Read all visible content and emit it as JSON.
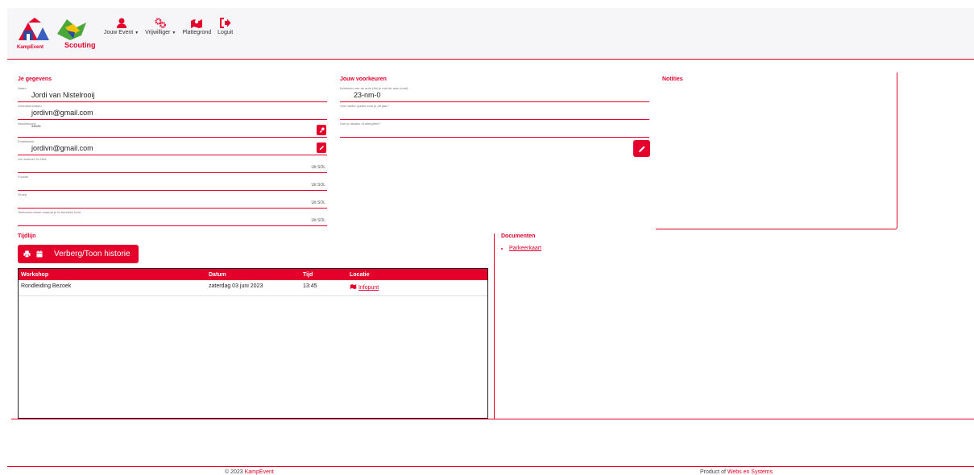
{
  "header": {
    "logo_text_1": "KampEvent",
    "logo_text_2": "Scouting",
    "nav": [
      {
        "label": "Jouw Event",
        "icon": "user-icon",
        "has_caret": true
      },
      {
        "label": "Vrijwilliger",
        "icon": "gears-icon",
        "has_caret": true
      },
      {
        "label": "Plattegrond",
        "icon": "map-icon",
        "has_caret": false
      },
      {
        "label": "Loguit",
        "icon": "sign-out-icon",
        "has_caret": false
      }
    ]
  },
  "personal": {
    "title": "Je gegevens",
    "fields": [
      {
        "label": "Naam",
        "value": "Jordi van Nistelrooij"
      },
      {
        "label": "Gebruikersnaam",
        "value": "jordivn@gmail.com"
      },
      {
        "label": "Wachtwoord",
        "value": "*****"
      },
      {
        "label": "Emailadres",
        "value": "jordivn@gmail.com"
      },
      {
        "label": "Lid nummer Sc Ned.",
        "value": "",
        "suffix": "Uit SOL"
      },
      {
        "label": "Functie",
        "value": "",
        "suffix": "Uit SOL"
      },
      {
        "label": "Groep",
        "value": "",
        "suffix": "Uit SOL"
      },
      {
        "label": "Telefoonnummer waarop je te bereiken bent",
        "value": "",
        "suffix": "Uit SOL"
      }
    ]
  },
  "preferences": {
    "title": "Jouw voorkeuren",
    "fields": [
      {
        "label": "Kenteken van de auto (Als je met de auto komt)",
        "value": "23-nm-0"
      },
      {
        "label": "Voor welke spelbe kom je dit jaar?",
        "value": ""
      },
      {
        "label": "Hoe je disdeln of allergieën?",
        "value": ""
      }
    ]
  },
  "notes": {
    "title": "Notities"
  },
  "timeline": {
    "title": "Tijdlijn",
    "toggle_label": "Verberg/Toon historie",
    "columns": [
      "Workshop",
      "Datum",
      "Tijd",
      "Locatie"
    ],
    "rows": [
      {
        "workshop": "Rondleiding Bezoek",
        "datum": "zaterdag 03 juni 2023",
        "tijd": "13:45",
        "locatie": "Infopunt"
      }
    ]
  },
  "documents": {
    "title": "Documenten",
    "items": [
      "Parkeerkaart"
    ]
  },
  "footer": {
    "copyright_prefix": "© 2023 ",
    "copyright_brand": "KampEvent",
    "product_prefix": "Product of ",
    "product_brand": "Webs en Systems"
  },
  "colors": {
    "accent": "#e4002b",
    "header_bg": "#f6f6f8"
  }
}
